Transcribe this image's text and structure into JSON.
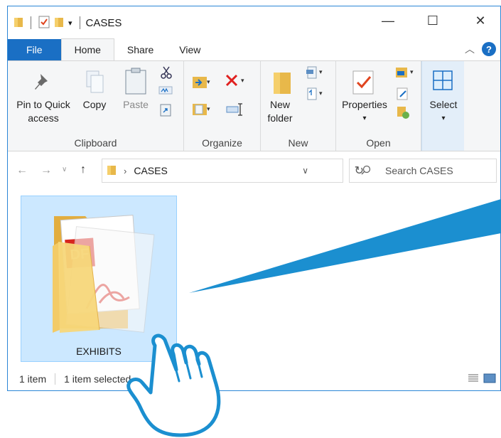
{
  "window": {
    "title": "CASES",
    "controls": {
      "minimize": "—",
      "maximize": "☐",
      "close": "✕"
    }
  },
  "ribbon": {
    "tabs": [
      {
        "label": "File"
      },
      {
        "label": "Home"
      },
      {
        "label": "Share"
      },
      {
        "label": "View"
      }
    ],
    "help": "?",
    "groups": {
      "clipboard": {
        "label": "Clipboard",
        "pin_line1": "Pin to Quick",
        "pin_line2": "access",
        "copy": "Copy",
        "paste": "Paste"
      },
      "organize": {
        "label": "Organize"
      },
      "new": {
        "label": "New",
        "new_folder_line1": "New",
        "new_folder_line2": "folder"
      },
      "open": {
        "label": "Open",
        "properties": "Properties"
      },
      "select": {
        "label": "Select"
      }
    }
  },
  "address": {
    "path": "CASES",
    "search_placeholder": "Search CASES"
  },
  "content": {
    "items": [
      {
        "name": "EXHIBITS",
        "type": "folder",
        "selected": true
      }
    ]
  },
  "status": {
    "item_count": "1 item",
    "selection": "1 item selected"
  },
  "colors": {
    "accent": "#1a6fc4",
    "selection_bg": "#cce8ff",
    "arrow": "#1b8fd0"
  }
}
